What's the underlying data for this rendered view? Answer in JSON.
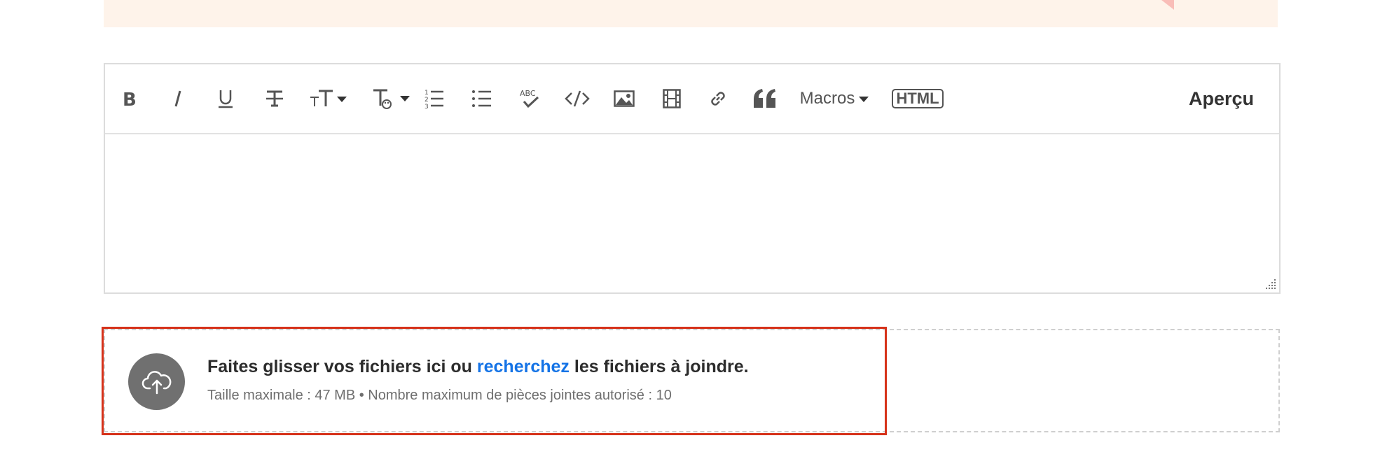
{
  "toolbar": {
    "buttons": [
      {
        "name": "bold",
        "icon": "bold-icon"
      },
      {
        "name": "italic",
        "icon": "italic-icon"
      },
      {
        "name": "underline",
        "icon": "underline-icon"
      },
      {
        "name": "strikethrough",
        "icon": "strikethrough-icon"
      },
      {
        "name": "font-size",
        "icon": "font-size-icon"
      },
      {
        "name": "font-style",
        "icon": "font-color-icon"
      },
      {
        "name": "ordered-list",
        "icon": "ordered-list-icon"
      },
      {
        "name": "bullet-list",
        "icon": "bullet-list-icon"
      },
      {
        "name": "spellcheck",
        "icon": "spellcheck-icon"
      },
      {
        "name": "code",
        "icon": "code-icon"
      },
      {
        "name": "image",
        "icon": "image-icon"
      },
      {
        "name": "video",
        "icon": "film-icon"
      },
      {
        "name": "link",
        "icon": "link-icon"
      },
      {
        "name": "quote",
        "icon": "quote-icon"
      }
    ],
    "spellcheck_text": "ABC",
    "macros_label": "Macros",
    "html_label": "HTML",
    "preview_label": "Aperçu"
  },
  "upload": {
    "text_before": "Faites glisser vos fichiers ici ou ",
    "link_text": "recherchez",
    "text_after": " les fichiers à joindre.",
    "limits": "Taille maximale : 47 MB • Nombre maximum de pièces jointes autorisé : 10",
    "icon": "cloud-upload-icon"
  },
  "colors": {
    "banner": "#fef3ea",
    "link": "#1473e6",
    "highlight": "#d6321a",
    "upload_circle": "#707070"
  }
}
